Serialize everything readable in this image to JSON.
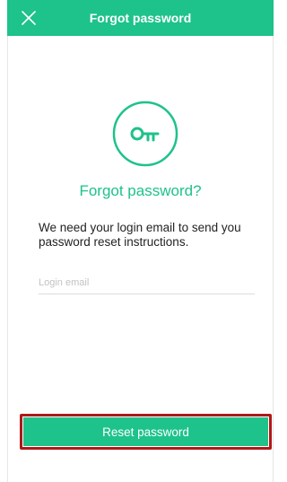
{
  "header": {
    "title": "Forgot password",
    "close_icon": "close-icon"
  },
  "main": {
    "icon": "key-icon",
    "heading": "Forgot password?",
    "description": "We need your login email to send you password reset instructions.",
    "email_field": {
      "placeholder": "Login email",
      "value": ""
    }
  },
  "footer": {
    "reset_label": "Reset password"
  },
  "colors": {
    "accent": "#1ec28b",
    "highlight_border": "#b01818",
    "text": "#222222"
  }
}
